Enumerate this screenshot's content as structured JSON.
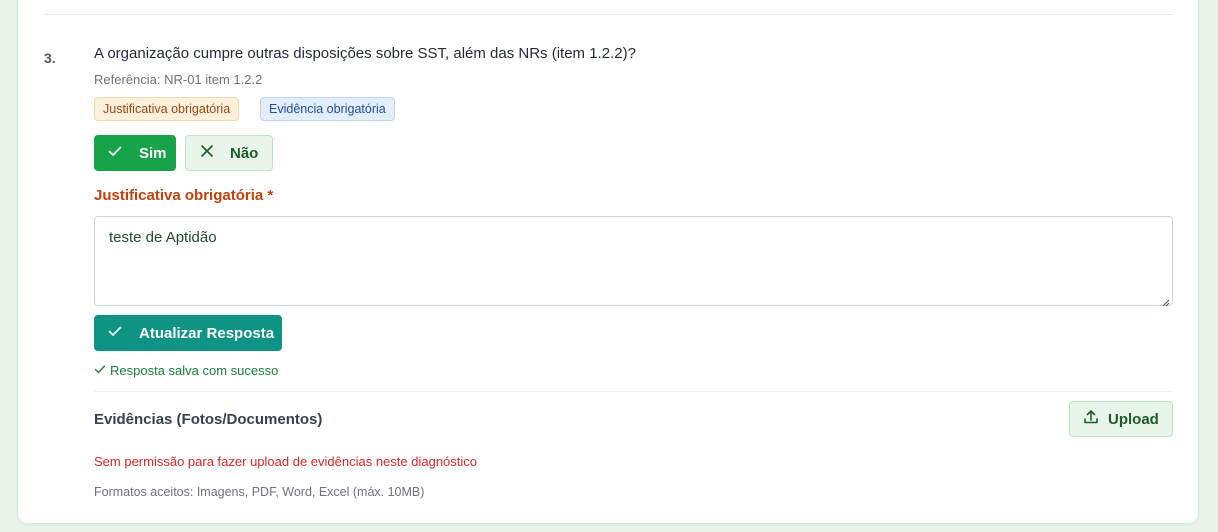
{
  "question": {
    "number": "3.",
    "text": "A organização cumpre outras disposições sobre SST, além das NRs (item 1.2.2)?",
    "reference": "Referência: NR-01 item 1.2.2",
    "tags": {
      "justificativa": "Justificativa obrigatória",
      "evidencia": "Evidência obrigatória"
    }
  },
  "answer": {
    "yes_label": "Sim",
    "no_label": "Não",
    "selected": "Sim"
  },
  "justification": {
    "label": "Justificativa obrigatória *",
    "value": "teste de Aptidão"
  },
  "actions": {
    "update_label": "Atualizar Resposta",
    "success_message": "Resposta salva com sucesso"
  },
  "evidence": {
    "title": "Evidências (Fotos/Documentos)",
    "upload_label": "Upload",
    "error_message": "Sem permissão para fazer upload de evidências neste diagnóstico",
    "formats_note": "Formatos aceitos: Imagens, PDF, Word, Excel (máx. 10MB)"
  },
  "colors": {
    "background": "#e9f5e9",
    "yes_button": "#16a34a",
    "update_button": "#0e9384",
    "required_label": "#c2410c",
    "error": "#dc2626",
    "success": "#15803d"
  },
  "icons": {
    "yes": "check-icon",
    "no": "x-icon",
    "update": "check-icon",
    "success": "check-icon",
    "upload": "upload-icon"
  }
}
